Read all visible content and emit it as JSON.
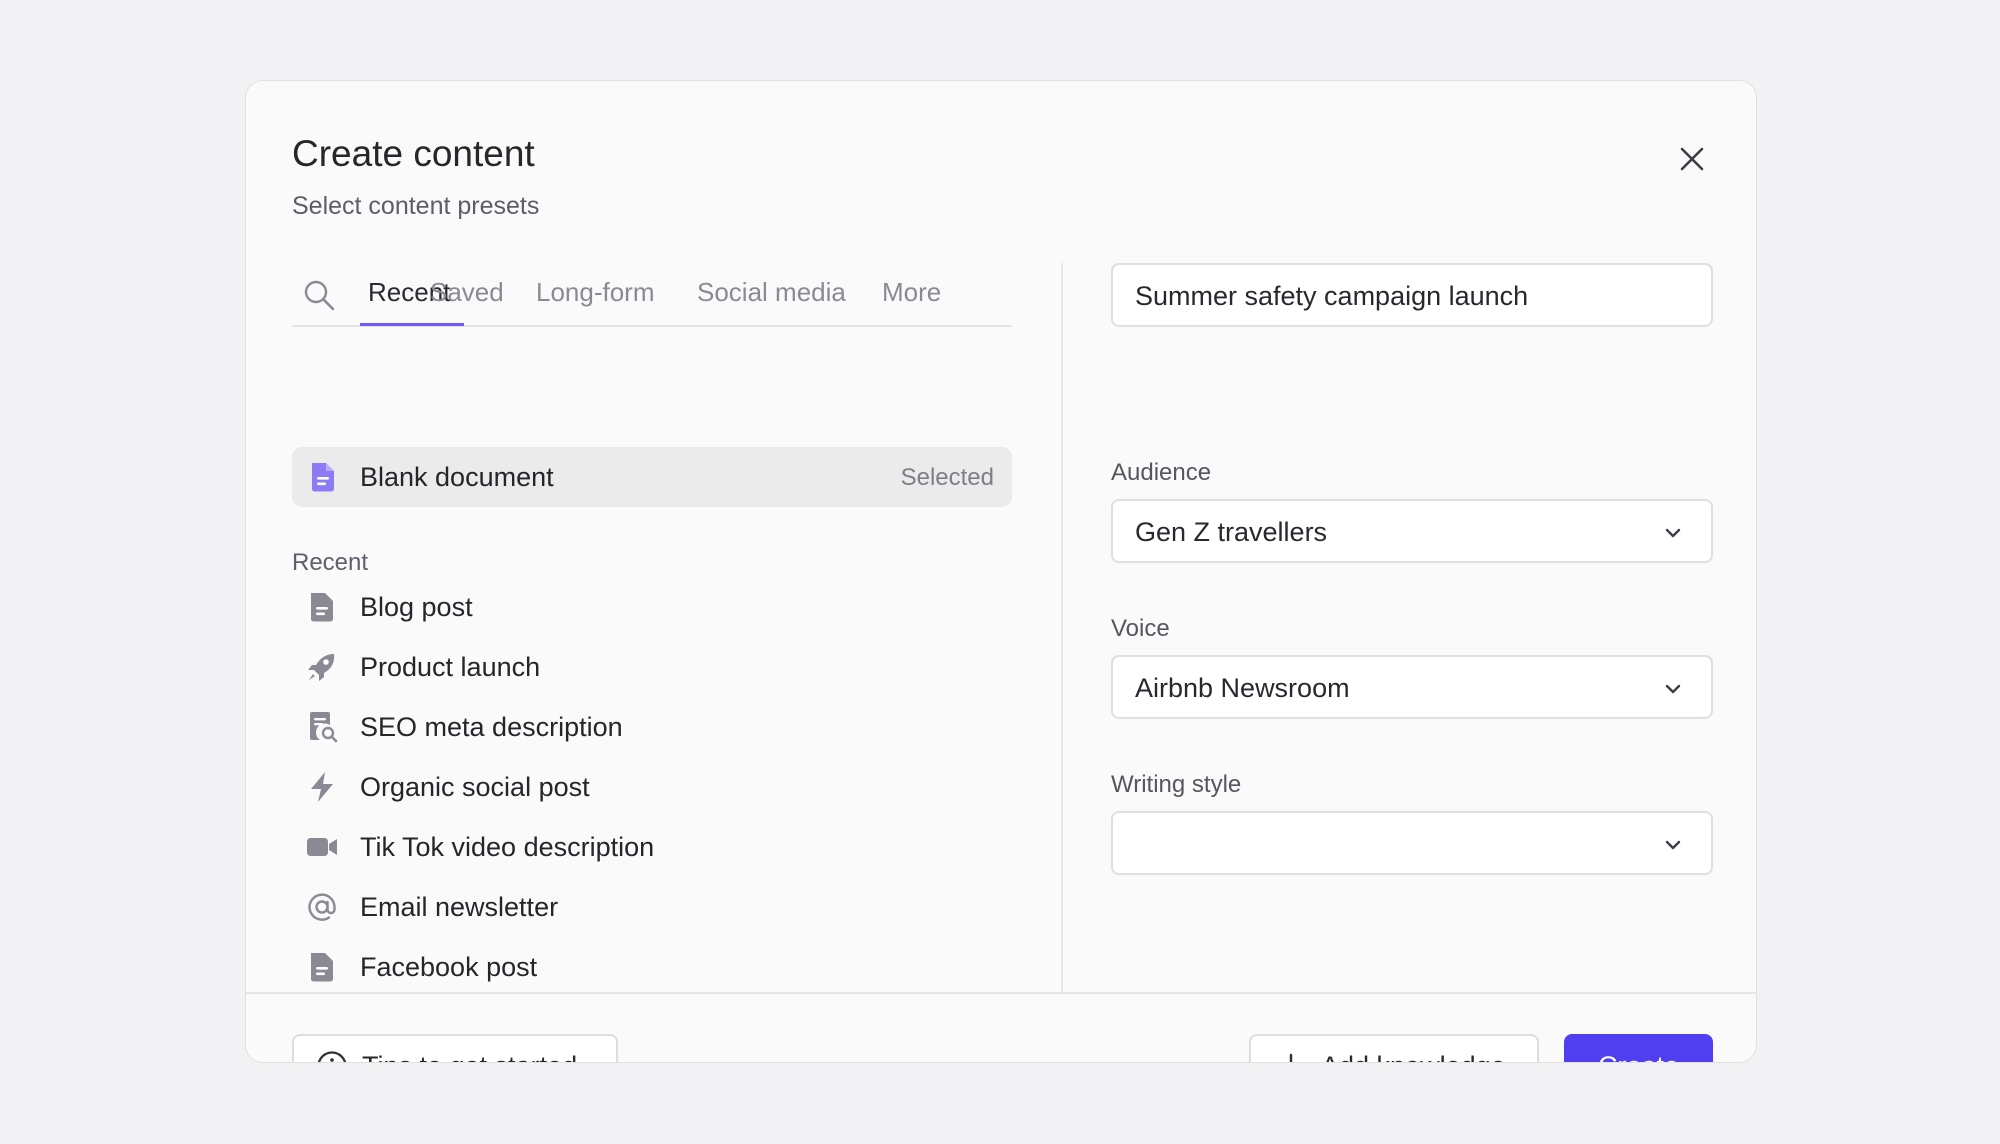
{
  "dialog": {
    "title": "Create content",
    "subtitle": "Select content presets"
  },
  "tabs": [
    {
      "label": "Recent",
      "active": true
    },
    {
      "label": "Saved",
      "active": false
    },
    {
      "label": "Long-form",
      "active": false
    },
    {
      "label": "Social media",
      "active": false
    },
    {
      "label": "More",
      "active": false
    }
  ],
  "selected_preset": {
    "label": "Blank document",
    "tag": "Selected",
    "icon": "document-icon"
  },
  "recent_section_label": "Recent",
  "recent_items": [
    {
      "label": "Blog post",
      "icon": "document-icon"
    },
    {
      "label": "Product launch",
      "icon": "rocket-icon"
    },
    {
      "label": "SEO meta description",
      "icon": "document-search-icon"
    },
    {
      "label": "Organic social post",
      "icon": "lightning-icon"
    },
    {
      "label": "Tik Tok video description",
      "icon": "video-camera-icon"
    },
    {
      "label": "Email newsletter",
      "icon": "at-sign-icon"
    },
    {
      "label": "Facebook post",
      "icon": "document-icon"
    }
  ],
  "form": {
    "name_value": "Summer safety campaign launch",
    "audience": {
      "label": "Audience",
      "value": "Gen Z travellers"
    },
    "voice": {
      "label": "Voice",
      "value": "Airbnb Newsroom"
    },
    "writing_style": {
      "label": "Writing style",
      "value": ""
    }
  },
  "footer": {
    "tips_label": "Tips to get started",
    "add_knowledge_label": "Add knowledge",
    "create_label": "Create"
  },
  "colors": {
    "accent": "#4f3ff0",
    "tab_underline": "#6d5bf3",
    "selected_icon": "#8b7cf6",
    "icon_gray": "#8a8a94"
  }
}
